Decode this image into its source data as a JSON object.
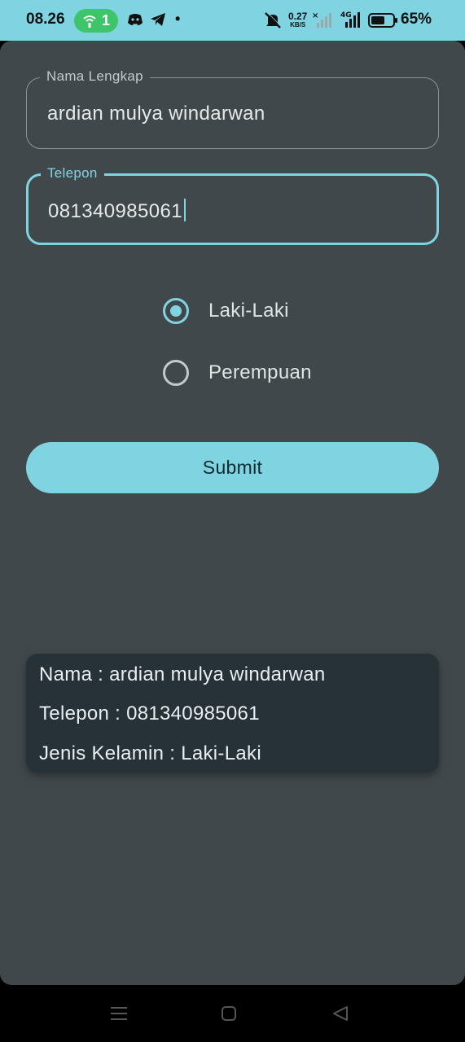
{
  "status_bar": {
    "time": "08.26",
    "hotspot_count": "1",
    "net_speed_value": "0.27",
    "net_speed_unit": "KB/S",
    "network_type": "4G",
    "battery_percent": "65%"
  },
  "form": {
    "name_field": {
      "label": "Nama Lengkap",
      "value": "ardian mulya windarwan"
    },
    "phone_field": {
      "label": "Telepon",
      "value": "081340985061"
    },
    "gender_options": [
      {
        "label": "Laki-Laki",
        "selected": true
      },
      {
        "label": "Perempuan",
        "selected": false
      }
    ],
    "submit_label": "Submit"
  },
  "result_card": {
    "name_line": "Nama : ardian mulya windarwan",
    "phone_line": "Telepon : 081340985061",
    "gender_line": "Jenis Kelamin : Laki-Laki"
  },
  "colors": {
    "accent": "#80d4e2",
    "surface": "#41484b",
    "card": "#263238",
    "hotspot": "#3ec469"
  },
  "icons": [
    "hotspot-icon",
    "discord-icon",
    "telegram-icon",
    "notification-dot-icon",
    "mute-icon",
    "signal-x-icon",
    "signal-4g-icon",
    "battery-icon",
    "menu-icon",
    "home-icon",
    "back-icon"
  ]
}
